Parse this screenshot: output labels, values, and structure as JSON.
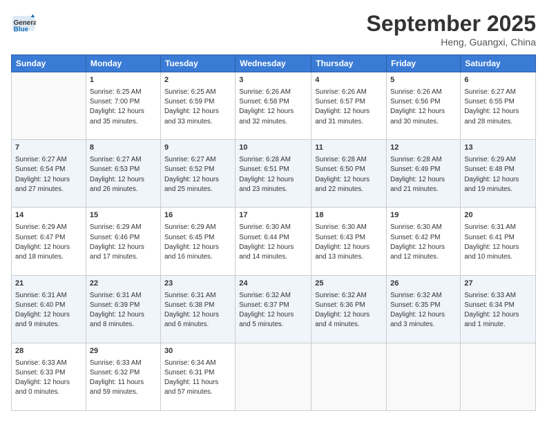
{
  "header": {
    "logo_general": "General",
    "logo_blue": "Blue",
    "month_title": "September 2025",
    "location": "Heng, Guangxi, China"
  },
  "days_of_week": [
    "Sunday",
    "Monday",
    "Tuesday",
    "Wednesday",
    "Thursday",
    "Friday",
    "Saturday"
  ],
  "weeks": [
    {
      "shade": false,
      "days": [
        {
          "num": "",
          "info": ""
        },
        {
          "num": "1",
          "info": "Sunrise: 6:25 AM\nSunset: 7:00 PM\nDaylight: 12 hours\nand 35 minutes."
        },
        {
          "num": "2",
          "info": "Sunrise: 6:25 AM\nSunset: 6:59 PM\nDaylight: 12 hours\nand 33 minutes."
        },
        {
          "num": "3",
          "info": "Sunrise: 6:26 AM\nSunset: 6:58 PM\nDaylight: 12 hours\nand 32 minutes."
        },
        {
          "num": "4",
          "info": "Sunrise: 6:26 AM\nSunset: 6:57 PM\nDaylight: 12 hours\nand 31 minutes."
        },
        {
          "num": "5",
          "info": "Sunrise: 6:26 AM\nSunset: 6:56 PM\nDaylight: 12 hours\nand 30 minutes."
        },
        {
          "num": "6",
          "info": "Sunrise: 6:27 AM\nSunset: 6:55 PM\nDaylight: 12 hours\nand 28 minutes."
        }
      ]
    },
    {
      "shade": true,
      "days": [
        {
          "num": "7",
          "info": "Sunrise: 6:27 AM\nSunset: 6:54 PM\nDaylight: 12 hours\nand 27 minutes."
        },
        {
          "num": "8",
          "info": "Sunrise: 6:27 AM\nSunset: 6:53 PM\nDaylight: 12 hours\nand 26 minutes."
        },
        {
          "num": "9",
          "info": "Sunrise: 6:27 AM\nSunset: 6:52 PM\nDaylight: 12 hours\nand 25 minutes."
        },
        {
          "num": "10",
          "info": "Sunrise: 6:28 AM\nSunset: 6:51 PM\nDaylight: 12 hours\nand 23 minutes."
        },
        {
          "num": "11",
          "info": "Sunrise: 6:28 AM\nSunset: 6:50 PM\nDaylight: 12 hours\nand 22 minutes."
        },
        {
          "num": "12",
          "info": "Sunrise: 6:28 AM\nSunset: 6:49 PM\nDaylight: 12 hours\nand 21 minutes."
        },
        {
          "num": "13",
          "info": "Sunrise: 6:29 AM\nSunset: 6:48 PM\nDaylight: 12 hours\nand 19 minutes."
        }
      ]
    },
    {
      "shade": false,
      "days": [
        {
          "num": "14",
          "info": "Sunrise: 6:29 AM\nSunset: 6:47 PM\nDaylight: 12 hours\nand 18 minutes."
        },
        {
          "num": "15",
          "info": "Sunrise: 6:29 AM\nSunset: 6:46 PM\nDaylight: 12 hours\nand 17 minutes."
        },
        {
          "num": "16",
          "info": "Sunrise: 6:29 AM\nSunset: 6:45 PM\nDaylight: 12 hours\nand 16 minutes."
        },
        {
          "num": "17",
          "info": "Sunrise: 6:30 AM\nSunset: 6:44 PM\nDaylight: 12 hours\nand 14 minutes."
        },
        {
          "num": "18",
          "info": "Sunrise: 6:30 AM\nSunset: 6:43 PM\nDaylight: 12 hours\nand 13 minutes."
        },
        {
          "num": "19",
          "info": "Sunrise: 6:30 AM\nSunset: 6:42 PM\nDaylight: 12 hours\nand 12 minutes."
        },
        {
          "num": "20",
          "info": "Sunrise: 6:31 AM\nSunset: 6:41 PM\nDaylight: 12 hours\nand 10 minutes."
        }
      ]
    },
    {
      "shade": true,
      "days": [
        {
          "num": "21",
          "info": "Sunrise: 6:31 AM\nSunset: 6:40 PM\nDaylight: 12 hours\nand 9 minutes."
        },
        {
          "num": "22",
          "info": "Sunrise: 6:31 AM\nSunset: 6:39 PM\nDaylight: 12 hours\nand 8 minutes."
        },
        {
          "num": "23",
          "info": "Sunrise: 6:31 AM\nSunset: 6:38 PM\nDaylight: 12 hours\nand 6 minutes."
        },
        {
          "num": "24",
          "info": "Sunrise: 6:32 AM\nSunset: 6:37 PM\nDaylight: 12 hours\nand 5 minutes."
        },
        {
          "num": "25",
          "info": "Sunrise: 6:32 AM\nSunset: 6:36 PM\nDaylight: 12 hours\nand 4 minutes."
        },
        {
          "num": "26",
          "info": "Sunrise: 6:32 AM\nSunset: 6:35 PM\nDaylight: 12 hours\nand 3 minutes."
        },
        {
          "num": "27",
          "info": "Sunrise: 6:33 AM\nSunset: 6:34 PM\nDaylight: 12 hours\nand 1 minute."
        }
      ]
    },
    {
      "shade": false,
      "days": [
        {
          "num": "28",
          "info": "Sunrise: 6:33 AM\nSunset: 6:33 PM\nDaylight: 12 hours\nand 0 minutes."
        },
        {
          "num": "29",
          "info": "Sunrise: 6:33 AM\nSunset: 6:32 PM\nDaylight: 11 hours\nand 59 minutes."
        },
        {
          "num": "30",
          "info": "Sunrise: 6:34 AM\nSunset: 6:31 PM\nDaylight: 11 hours\nand 57 minutes."
        },
        {
          "num": "",
          "info": ""
        },
        {
          "num": "",
          "info": ""
        },
        {
          "num": "",
          "info": ""
        },
        {
          "num": "",
          "info": ""
        }
      ]
    }
  ]
}
